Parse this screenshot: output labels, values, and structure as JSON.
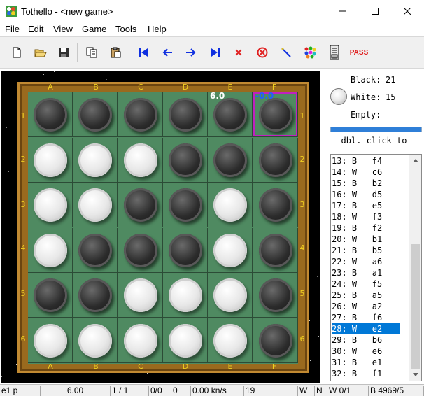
{
  "window": {
    "title": "Tothello - <new game>"
  },
  "menu": [
    "File",
    "Edit",
    "View",
    "Game",
    "Tools",
    "Help"
  ],
  "toolbar": {
    "icons": [
      "new-file-icon",
      "open-folder-icon",
      "save-icon",
      "copy-icon",
      "paste-icon",
      "first-move-icon",
      "back-icon",
      "forward-icon",
      "last-move-icon",
      "stop-icon",
      "cancel-icon",
      "wand-icon",
      "colors-icon",
      "computer-icon"
    ],
    "pass_label": "PASS"
  },
  "board": {
    "columns": [
      "A",
      "B",
      "C",
      "D",
      "E",
      "F"
    ],
    "rows": [
      "1",
      "2",
      "3",
      "4",
      "5",
      "6"
    ],
    "cells": [
      [
        "B",
        "B",
        "B",
        "B",
        "B",
        "B"
      ],
      [
        "W",
        "W",
        "W",
        "B",
        "B",
        "B"
      ],
      [
        "W",
        "W",
        "B",
        "B",
        "W",
        "B"
      ],
      [
        "W",
        "B",
        "B",
        "B",
        "W",
        "B"
      ],
      [
        "B",
        "B",
        "W",
        "W",
        "W",
        "B"
      ],
      [
        "W",
        "W",
        "W",
        "W",
        "W",
        "B"
      ]
    ],
    "evals": [
      {
        "text": "6.0",
        "col": 4,
        "row": 0,
        "color": "#ffffff"
      },
      {
        "text": "-0.0",
        "col": 5,
        "row": 0,
        "color": "#2060ff"
      }
    ],
    "highlight": {
      "col": 5,
      "row": 0
    }
  },
  "info": {
    "black_label": "Black:",
    "black_value": "21",
    "white_label": "White:",
    "white_value": "15",
    "empty_label": "Empty:",
    "hint": "dbl. click to"
  },
  "moves": [
    {
      "text": "13: B   f4"
    },
    {
      "text": "14: W   c6"
    },
    {
      "text": "15: B   b2"
    },
    {
      "text": "16: W   d5"
    },
    {
      "text": "17: B   e5"
    },
    {
      "text": "18: W   f3"
    },
    {
      "text": "19: B   f2"
    },
    {
      "text": "20: W   b1"
    },
    {
      "text": "21: B   b5"
    },
    {
      "text": "22: W   a6"
    },
    {
      "text": "23: B   a1"
    },
    {
      "text": "24: W   f5"
    },
    {
      "text": "25: B   a5"
    },
    {
      "text": "26: W   a2"
    },
    {
      "text": "27: B   f6"
    },
    {
      "text": "28: W   e2",
      "selected": true
    },
    {
      "text": "29: B   b6"
    },
    {
      "text": "30: W   e6"
    },
    {
      "text": "31: B   e1"
    },
    {
      "text": "32: B   f1"
    }
  ],
  "status": [
    "e1 p",
    "6.00",
    "1 / 1",
    "0/0",
    "0",
    "0.00 kn/s",
    "19",
    "W",
    "N",
    "W 0/1",
    "B 4969/5"
  ]
}
